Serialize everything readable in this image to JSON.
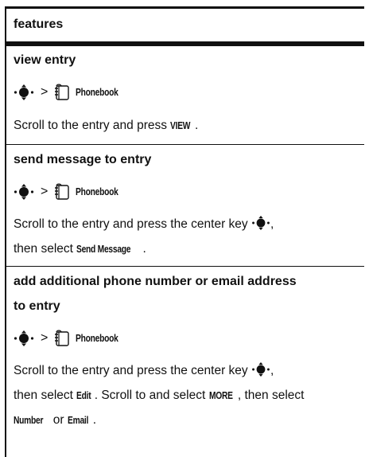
{
  "header": {
    "title": "features"
  },
  "nav_path": {
    "separator": ">",
    "menu": "Phonebook"
  },
  "sections": [
    {
      "title": "view entry",
      "desc_prefix": "Scroll to the entry and press ",
      "desc_key": "VIEW",
      "desc_suffix": "."
    },
    {
      "title": "send message to entry",
      "line1": "Scroll to the entry and press the center key",
      "line1_end": ",",
      "line2_prefix": "then select ",
      "line2_key": "Send Message",
      "line2_suffix": "."
    },
    {
      "title_line1": "add additional phone number or email address",
      "title_line2": "to entry",
      "line1": "Scroll to the entry and press the center key",
      "line1_end": ",",
      "line2_prefix": "then select ",
      "line2_key1": "Edit",
      "line2_mid": ". Scroll to and select ",
      "line2_key2": "MORE",
      "line2_suffix": ", then select",
      "line3_key1": "Number",
      "line3_mid": " or ",
      "line3_key2": "Email",
      "line3_suffix": "."
    }
  ],
  "icons": {
    "nav": "navigation-key-icon",
    "phonebook": "phonebook-icon"
  }
}
